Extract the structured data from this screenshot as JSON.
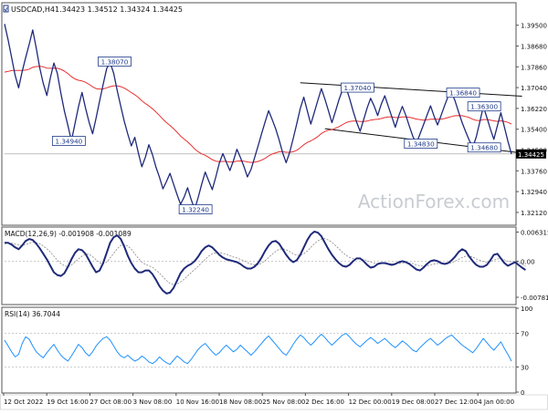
{
  "symbol_header": {
    "symbol": "USDCAD,H4",
    "ohlc": "1.34423 1.34512 1.34324 1.34425"
  },
  "watermark": "ActionForex.com",
  "chart_data": [
    {
      "type": "line",
      "title": "USDCAD,H4 1.34423 1.34512 1.34324 1.34425",
      "ylim": [
        1.3165,
        1.4035
      ],
      "y_ticks": [
        1.3212,
        1.3294,
        1.3376,
        1.3458,
        1.354,
        1.3622,
        1.3704,
        1.3786,
        1.3868,
        1.395
      ],
      "y_tick_labels": [
        "1.32120",
        "1.32940",
        "1.33760",
        "1.34580",
        "1.35400",
        "1.36220",
        "1.37040",
        "1.37860",
        "1.38680",
        "1.39500"
      ],
      "current_price": 1.34425,
      "current_price_label": "1.34425",
      "x_tick_labels": [
        "12 Oct 2022",
        "19 Oct 16:00",
        "27 Oct 08:00",
        "3 Nov 08:00",
        "10 Nov 16:00",
        "18 Nov 08:00",
        "25 Nov 08:00",
        "2 Dec 16:00",
        "12 Dec 00:00",
        "19 Dec 08:00",
        "27 Dec 12:00",
        "4 Jan 00:00"
      ],
      "price_labels": [
        {
          "text": "1.38070",
          "value": 1.3807,
          "bar": 31
        },
        {
          "text": "1.34940",
          "value": 1.3494,
          "bar": 18
        },
        {
          "text": "1.32240",
          "value": 1.3224,
          "bar": 54
        },
        {
          "text": "1.37040",
          "value": 1.3704,
          "bar": 100
        },
        {
          "text": "1.34830",
          "value": 1.3483,
          "bar": 118
        },
        {
          "text": "1.36840",
          "value": 1.3684,
          "bar": 130
        },
        {
          "text": "1.36300",
          "value": 1.363,
          "bar": 136
        },
        {
          "text": "1.34680",
          "value": 1.3468,
          "bar": 136
        }
      ],
      "channel": {
        "upper": [
          {
            "bar": 84,
            "value": 1.3723
          },
          {
            "bar": 147,
            "value": 1.367
          }
        ],
        "lower": [
          {
            "bar": 91,
            "value": 1.3542
          },
          {
            "bar": 147,
            "value": 1.3446
          }
        ]
      },
      "series": [
        {
          "color": "#1f2a7a",
          "values": [
            1.3955,
            1.3892,
            1.3823,
            1.3752,
            1.3703,
            1.3768,
            1.3822,
            1.3875,
            1.3931,
            1.386,
            1.3782,
            1.372,
            1.3673,
            1.3742,
            1.3801,
            1.376,
            1.3681,
            1.3612,
            1.3554,
            1.3494,
            1.3562,
            1.3628,
            1.3685,
            1.3624,
            1.3568,
            1.3522,
            1.3584,
            1.3652,
            1.3716,
            1.3779,
            1.3803,
            1.376,
            1.3693,
            1.3631,
            1.3572,
            1.3521,
            1.3474,
            1.3508,
            1.3446,
            1.3392,
            1.343,
            1.3479,
            1.344,
            1.3391,
            1.3351,
            1.3305,
            1.3334,
            1.3366,
            1.3324,
            1.3282,
            1.3244,
            1.3272,
            1.3309,
            1.3263,
            1.3224,
            1.3271,
            1.3323,
            1.3371,
            1.3336,
            1.3302,
            1.3352,
            1.3406,
            1.3444,
            1.341,
            1.3377,
            1.3415,
            1.3461,
            1.3429,
            1.3393,
            1.3352,
            1.3381,
            1.3426,
            1.3473,
            1.3522,
            1.3568,
            1.3613,
            1.3579,
            1.3542,
            1.3498,
            1.3447,
            1.3408,
            1.3449,
            1.3503,
            1.3561,
            1.3622,
            1.3666,
            1.3612,
            1.356,
            1.3607,
            1.3654,
            1.37,
            1.3659,
            1.3613,
            1.3566,
            1.361,
            1.3656,
            1.3695,
            1.3704,
            1.3662,
            1.3612,
            1.3568,
            1.3532,
            1.3577,
            1.3624,
            1.3662,
            1.3631,
            1.3594,
            1.3638,
            1.3672,
            1.3631,
            1.3589,
            1.3548,
            1.3594,
            1.363,
            1.3594,
            1.3552,
            1.3511,
            1.3483,
            1.3521,
            1.3557,
            1.3595,
            1.3632,
            1.3592,
            1.3557,
            1.3594,
            1.3633,
            1.3669,
            1.3684,
            1.3651,
            1.3607,
            1.3566,
            1.353,
            1.3496,
            1.3468,
            1.351,
            1.3568,
            1.363,
            1.3587,
            1.3541,
            1.35,
            1.3554,
            1.3605,
            1.3548,
            1.3493,
            1.3442
          ]
        },
        {
          "color": "#e83030",
          "values": [
            1.3765,
            1.3768,
            1.3771,
            1.3772,
            1.3772,
            1.3772,
            1.3773,
            1.3777,
            1.3784,
            1.3787,
            1.3788,
            1.3786,
            1.3781,
            1.378,
            1.3781,
            1.378,
            1.3776,
            1.3769,
            1.3759,
            1.3747,
            1.3738,
            1.3733,
            1.373,
            1.3725,
            1.3717,
            1.3707,
            1.37,
            1.3698,
            1.3699,
            1.3703,
            1.3708,
            1.3711,
            1.3711,
            1.3708,
            1.3702,
            1.3694,
            1.3684,
            1.3676,
            1.3665,
            1.3652,
            1.3641,
            1.3632,
            1.3621,
            1.3608,
            1.3594,
            1.3579,
            1.3566,
            1.3555,
            1.3542,
            1.3528,
            1.3513,
            1.3501,
            1.349,
            1.3477,
            1.3462,
            1.3451,
            1.3443,
            1.3437,
            1.3429,
            1.342,
            1.3414,
            1.3412,
            1.3413,
            1.3413,
            1.3411,
            1.3411,
            1.3414,
            1.3415,
            1.3414,
            1.3411,
            1.3409,
            1.341,
            1.3413,
            1.3418,
            1.3425,
            1.3435,
            1.3442,
            1.3447,
            1.3451,
            1.3451,
            1.3449,
            1.3449,
            1.3451,
            1.3457,
            1.3467,
            1.3479,
            1.3488,
            1.3494,
            1.3502,
            1.3511,
            1.3523,
            1.3531,
            1.3536,
            1.3538,
            1.3544,
            1.355,
            1.3558,
            1.3566,
            1.357,
            1.3572,
            1.3572,
            1.357,
            1.357,
            1.3572,
            1.3576,
            1.3578,
            1.3579,
            1.3582,
            1.3586,
            1.3588,
            1.3588,
            1.3586,
            1.3586,
            1.3588,
            1.3588,
            1.3587,
            1.3584,
            1.358,
            1.3578,
            1.3576,
            1.3577,
            1.3579,
            1.358,
            1.3579,
            1.358,
            1.3582,
            1.3586,
            1.359,
            1.3593,
            1.3594,
            1.3593,
            1.359,
            1.3586,
            1.3579,
            1.3575,
            1.3574,
            1.3578,
            1.3578,
            1.3576,
            1.3573,
            1.3571,
            1.3573,
            1.3571,
            1.3567,
            1.356
          ]
        }
      ]
    },
    {
      "type": "line",
      "title": "MACD(12,26,9) -0.001908 -0.001089",
      "ylim": [
        -0.0092,
        0.0072
      ],
      "y_ticks": [
        0.006315,
        0.0,
        -0.007818
      ],
      "y_tick_labels": [
        "0.006315",
        "0.00",
        "-0.007818"
      ],
      "series": [
        {
          "color": "#1f2a7a",
          "values": [
            0.004,
            0.004,
            0.0036,
            0.003,
            0.0026,
            0.0034,
            0.0044,
            0.0048,
            0.0046,
            0.0038,
            0.0028,
            0.0016,
            0.0004,
            -0.001,
            -0.0024,
            -0.003,
            -0.0032,
            -0.0026,
            -0.0012,
            0.0004,
            0.0018,
            0.0026,
            0.0024,
            0.0016,
            0.0002,
            -0.0012,
            -0.0024,
            -0.002,
            -0.0004,
            0.0018,
            0.004,
            0.0052,
            0.0056,
            0.0048,
            0.0032,
            0.0012,
            -0.0004,
            -0.0016,
            -0.0024,
            -0.0024,
            -0.002,
            -0.002,
            -0.0028,
            -0.004,
            -0.0054,
            -0.0064,
            -0.007,
            -0.0068,
            -0.0058,
            -0.0042,
            -0.0026,
            -0.0016,
            -0.001,
            -0.0006,
            0.0,
            0.001,
            0.0022,
            0.003,
            0.0034,
            0.003,
            0.0022,
            0.0014,
            0.0008,
            0.0004,
            0.0002,
            0.0,
            -0.0002,
            -0.0006,
            -0.0012,
            -0.0016,
            -0.0016,
            -0.0012,
            -0.0004,
            0.0008,
            0.0022,
            0.0034,
            0.0042,
            0.0044,
            0.0038,
            0.0026,
            0.0014,
            0.0004,
            -0.0002,
            0.0002,
            0.0014,
            0.003,
            0.0046,
            0.0058,
            0.0064,
            0.0062,
            0.0054,
            0.004,
            0.0026,
            0.0014,
            0.0004,
            -0.0004,
            -0.001,
            -0.0012,
            -0.0008,
            0.0,
            0.0006,
            0.0006,
            0.0,
            -0.0008,
            -0.0014,
            -0.0012,
            -0.0006,
            -0.0004,
            -0.0004,
            -0.0006,
            -0.0008,
            -0.0006,
            -0.0002,
            0.0,
            -0.0002,
            -0.0006,
            -0.0012,
            -0.0018,
            -0.002,
            -0.0014,
            -0.0006,
            0.0,
            0.0002,
            0.0,
            -0.0004,
            -0.0006,
            -0.0004,
            0.0002,
            0.001,
            0.002,
            0.0026,
            0.0022,
            0.001,
            0.0,
            -0.0008,
            -0.0012,
            -0.0012,
            -0.0008,
            0.0002,
            0.0014,
            0.0016,
            0.0006,
            -0.0004,
            -0.001,
            -0.0006,
            -0.0002,
            -0.0008,
            -0.0014,
            -0.0019
          ]
        },
        {
          "color": "#888888",
          "values": [
            0.0038,
            0.0039,
            0.0039,
            0.0037,
            0.0035,
            0.0034,
            0.0036,
            0.0039,
            0.0041,
            0.004,
            0.0038,
            0.0033,
            0.0027,
            0.002,
            0.0011,
            0.0002,
            -0.0005,
            -0.001,
            -0.0012,
            -0.0008,
            -0.0002,
            0.0005,
            0.0011,
            0.0015,
            0.0015,
            0.001,
            0.0003,
            -0.0003,
            -0.0006,
            -0.0002,
            0.0007,
            0.0017,
            0.0027,
            0.0034,
            0.0036,
            0.0033,
            0.0026,
            0.0016,
            0.0006,
            -0.0002,
            -0.0007,
            -0.001,
            -0.0013,
            -0.0019,
            -0.0026,
            -0.0034,
            -0.0042,
            -0.0048,
            -0.0051,
            -0.005,
            -0.0045,
            -0.0039,
            -0.0032,
            -0.0025,
            -0.0018,
            -0.0011,
            -0.0003,
            0.0004,
            0.0011,
            0.0016,
            0.0018,
            0.0018,
            0.0017,
            0.0015,
            0.0012,
            0.0009,
            0.0007,
            0.0004,
            0.0001,
            -0.0003,
            -0.0006,
            -0.0008,
            -0.0008,
            -0.0004,
            0.0001,
            0.0008,
            0.0015,
            0.0021,
            0.0026,
            0.0027,
            0.0025,
            0.0021,
            0.0016,
            0.0013,
            0.0013,
            0.0016,
            0.0022,
            0.003,
            0.0038,
            0.0044,
            0.0048,
            0.0049,
            0.0046,
            0.0041,
            0.0034,
            0.0027,
            0.0019,
            0.0013,
            0.0008,
            0.0006,
            0.0005,
            0.0005,
            0.0004,
            0.0001,
            -0.0002,
            -0.0004,
            -0.0005,
            -0.0005,
            -0.0005,
            -0.0005,
            -0.0006,
            -0.0006,
            -0.0005,
            -0.0004,
            -0.0003,
            -0.0004,
            -0.0005,
            -0.0008,
            -0.001,
            -0.0011,
            -0.001,
            -0.0008,
            -0.0006,
            -0.0005,
            -0.0005,
            -0.0005,
            -0.0005,
            -0.0003,
            0.0,
            0.0004,
            0.0008,
            0.0011,
            0.0011,
            0.0009,
            0.0005,
            0.0002,
            -0.0001,
            -0.0002,
            -0.0001,
            0.0002,
            0.0005,
            0.0005,
            0.0003,
            0.0,
            -0.0001,
            -0.0001,
            -0.0003,
            -0.0005,
            -0.0011
          ]
        }
      ]
    },
    {
      "type": "line",
      "title": "RSI(14) 36.7044",
      "ylim": [
        0,
        100
      ],
      "y_ticks": [
        100,
        70,
        30,
        0
      ],
      "y_tick_labels": [
        "100",
        "70",
        "30",
        "0"
      ],
      "levels": [
        70,
        30
      ],
      "series": [
        {
          "color": "#1e90ff",
          "values": [
            62,
            55,
            48,
            42,
            45,
            58,
            66,
            63,
            55,
            48,
            44,
            41,
            47,
            52,
            57,
            50,
            44,
            40,
            37,
            43,
            50,
            57,
            53,
            47,
            43,
            48,
            55,
            60,
            64,
            66,
            62,
            55,
            48,
            43,
            41,
            44,
            40,
            37,
            39,
            43,
            40,
            36,
            34,
            37,
            42,
            38,
            35,
            33,
            38,
            43,
            40,
            36,
            34,
            39,
            45,
            51,
            55,
            58,
            53,
            48,
            44,
            47,
            52,
            56,
            52,
            48,
            51,
            56,
            52,
            48,
            44,
            48,
            53,
            58,
            63,
            67,
            62,
            57,
            52,
            47,
            44,
            50,
            57,
            63,
            68,
            65,
            60,
            56,
            60,
            65,
            69,
            65,
            60,
            56,
            60,
            64,
            68,
            70,
            66,
            61,
            57,
            54,
            58,
            62,
            65,
            62,
            58,
            61,
            64,
            60,
            56,
            53,
            57,
            61,
            58,
            54,
            50,
            48,
            53,
            57,
            61,
            64,
            60,
            56,
            59,
            63,
            66,
            68,
            64,
            60,
            56,
            53,
            50,
            47,
            52,
            58,
            64,
            59,
            54,
            50,
            55,
            60,
            52,
            45,
            37
          ]
        }
      ]
    }
  ]
}
